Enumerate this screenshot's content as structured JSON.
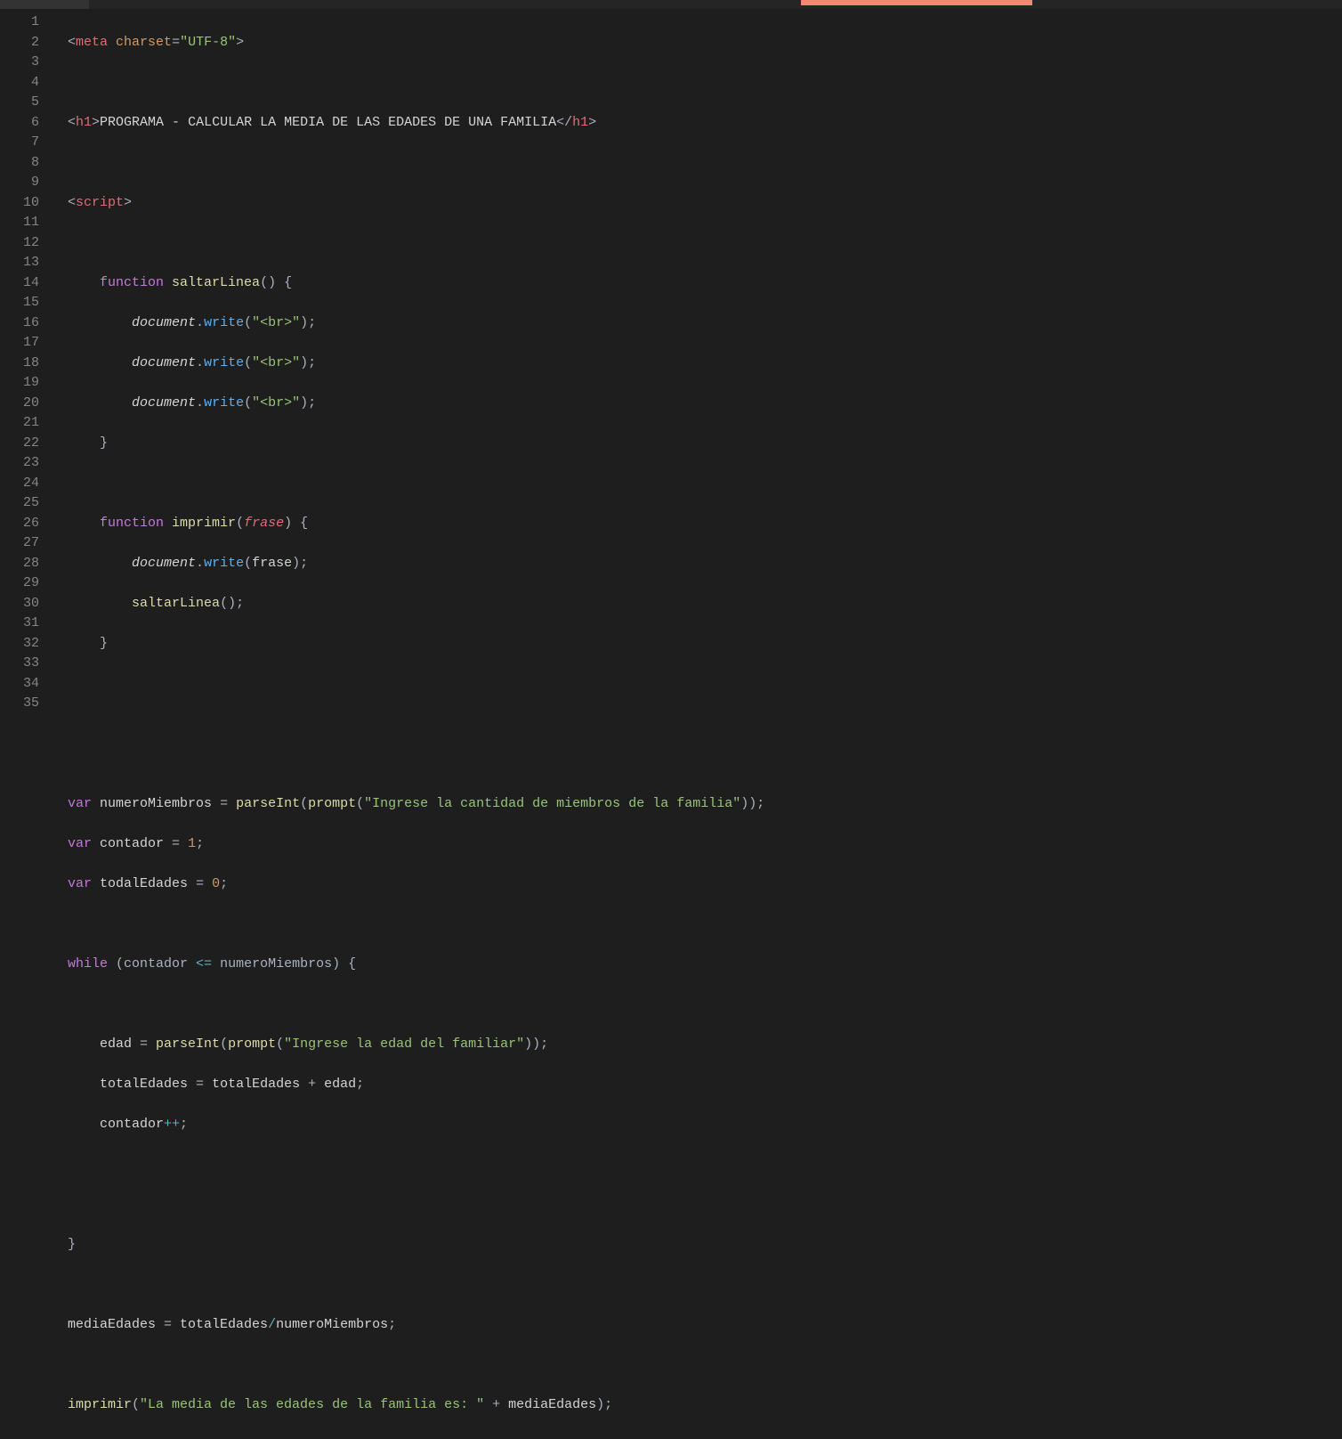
{
  "lines": {
    "count": 35,
    "numbers": [
      "1",
      "2",
      "3",
      "4",
      "5",
      "6",
      "7",
      "8",
      "9",
      "10",
      "11",
      "12",
      "13",
      "14",
      "15",
      "16",
      "17",
      "18",
      "19",
      "20",
      "21",
      "22",
      "23",
      "24",
      "25",
      "26",
      "27",
      "28",
      "29",
      "30",
      "31",
      "32",
      "33",
      "34",
      "35"
    ]
  },
  "code": {
    "l1_open": "<",
    "l1_tag": "meta",
    "l1_sp": " ",
    "l1_attr": "charset",
    "l1_eq": "=",
    "l1_val": "\"UTF-8\"",
    "l1_close": ">",
    "l3_open": "<",
    "l3_tag": "h1",
    "l3_gt": ">",
    "l3_text": "PROGRAMA - CALCULAR LA MEDIA DE LAS EDADES DE UNA FAMILIA",
    "l3_cl_open": "</",
    "l3_cl_tag": "h1",
    "l3_cl_gt": ">",
    "l5_open": "<",
    "l5_tag": "script",
    "l5_gt": ">",
    "l7_kw": "function",
    "l7_sp": " ",
    "l7_fn": "saltarLinea",
    "l7_par": "() {",
    "l8_doc": "document",
    "l8_dot": ".",
    "l8_write": "write",
    "l8_open": "(",
    "l8_str": "\"<br>\"",
    "l8_close": ");",
    "l11_brace": "}",
    "l13_kw": "function",
    "l13_sp": " ",
    "l13_fn": "imprimir",
    "l13_open": "(",
    "l13_param": "frase",
    "l13_close": ") {",
    "l14_doc": "document",
    "l14_dot": ".",
    "l14_write": "write",
    "l14_open": "(",
    "l14_arg": "frase",
    "l14_close": ");",
    "l15_fn": "saltarLinea",
    "l15_close": "();",
    "l16_brace": "}",
    "l20_kw": "var",
    "l20_sp": " ",
    "l20_id": "numeroMiembros",
    "l20_eq": " = ",
    "l20_fn": "parseInt",
    "l20_open": "(",
    "l20_fn2": "prompt",
    "l20_open2": "(",
    "l20_str": "\"Ingrese la cantidad de miembros de la familia\"",
    "l20_close": "));",
    "l21_kw": "var",
    "l21_sp": " ",
    "l21_id": "contador",
    "l21_eq": " = ",
    "l21_num": "1",
    "l21_semi": ";",
    "l22_kw": "var",
    "l22_sp": " ",
    "l22_id": "todalEdades",
    "l22_eq": " = ",
    "l22_num": "0",
    "l22_semi": ";",
    "l24_kw": "while",
    "l24_open": " (contador ",
    "l24_op": "<=",
    "l24_mid": " numeroMiembros) {",
    "l26_id": "edad",
    "l26_eq": " = ",
    "l26_fn": "parseInt",
    "l26_open": "(",
    "l26_fn2": "prompt",
    "l26_open2": "(",
    "l26_str": "\"Ingrese la edad del familiar\"",
    "l26_close": "));",
    "l27_id1": "totalEdades",
    "l27_eq": " = ",
    "l27_id2": "totalEdades",
    "l27_plus": " + ",
    "l27_id3": "edad",
    "l27_semi": ";",
    "l28_id": "contador",
    "l28_op": "++",
    "l28_semi": ";",
    "l31_brace": "}",
    "l33_id1": "mediaEdades",
    "l33_eq": " = ",
    "l33_id2": "totalEdades",
    "l33_div": "/",
    "l33_id3": "numeroMiembros",
    "l33_semi": ";",
    "l35_fn": "imprimir",
    "l35_open": "(",
    "l35_str": "\"La media de las edades de la familia es: \"",
    "l35_plus": " + ",
    "l35_id": "mediaEdades",
    "l35_close": ");"
  },
  "indent": {
    "i1": "    ",
    "i2": "        ",
    "guide1": "    ",
    "guide2": "    "
  }
}
